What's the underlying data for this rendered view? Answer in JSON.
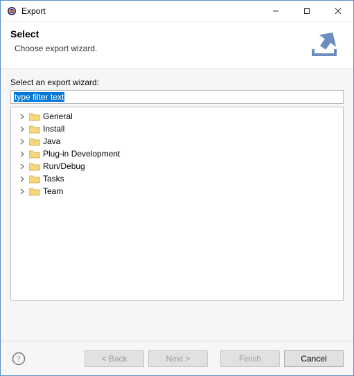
{
  "window": {
    "title": "Export"
  },
  "banner": {
    "heading": "Select",
    "subtitle": "Choose export wizard."
  },
  "main": {
    "label": "Select an export wizard:",
    "filter_placeholder": "type filter text",
    "filter_value": "type filter text",
    "categories": [
      {
        "label": "General"
      },
      {
        "label": "Install"
      },
      {
        "label": "Java"
      },
      {
        "label": "Plug-in Development"
      },
      {
        "label": "Run/Debug"
      },
      {
        "label": "Tasks"
      },
      {
        "label": "Team"
      }
    ]
  },
  "buttons": {
    "back": "< Back",
    "next": "Next >",
    "finish": "Finish",
    "cancel": "Cancel"
  }
}
